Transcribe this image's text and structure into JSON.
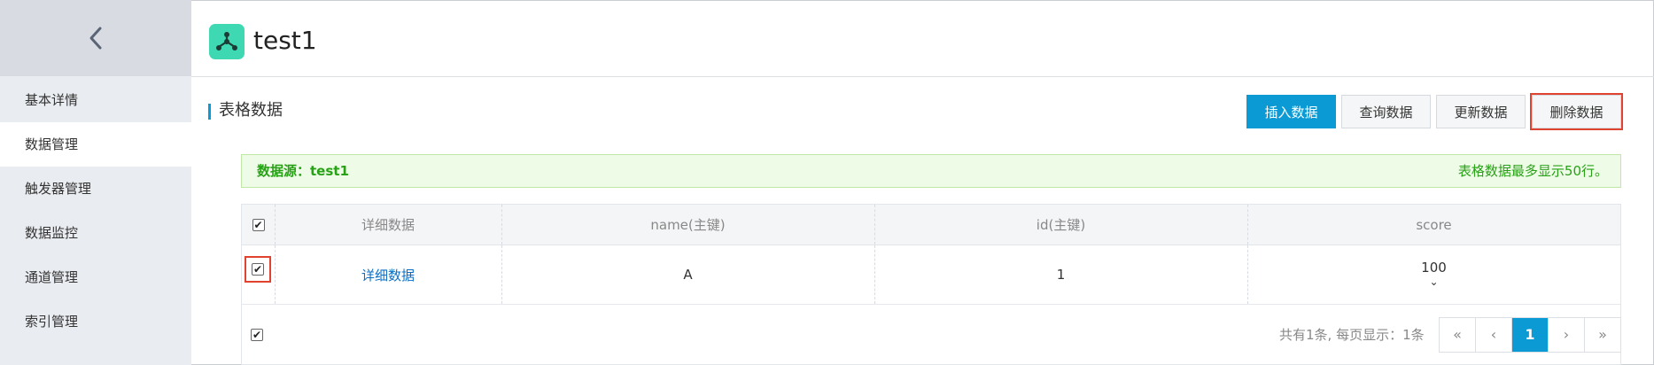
{
  "sidebar": {
    "items": [
      {
        "label": "基本详情"
      },
      {
        "label": "数据管理"
      },
      {
        "label": "触发器管理"
      },
      {
        "label": "数据监控"
      },
      {
        "label": "通道管理"
      },
      {
        "label": "索引管理"
      }
    ],
    "active_index": 1
  },
  "header": {
    "title": "test1",
    "logo_icon": "share-nodes-icon",
    "accent": "#3ed9b3"
  },
  "section": {
    "title": "表格数据"
  },
  "toolbar": {
    "insert": "插入数据",
    "query": "查询数据",
    "update": "更新数据",
    "delete": "删除数据"
  },
  "banner": {
    "left": "数据源：test1",
    "right": "表格数据最多显示50行。"
  },
  "table": {
    "headers": [
      "详细数据",
      "name(主键)",
      "id(主键)",
      "score"
    ],
    "rows": [
      {
        "checked": true,
        "detail_link": "详细数据",
        "name": "A",
        "id": "1",
        "score": "100"
      }
    ]
  },
  "pagination": {
    "info": "共有1条, 每页显示：1条",
    "first": "«",
    "prev": "‹",
    "current": "1",
    "next": "›",
    "last": "»"
  },
  "colors": {
    "primary": "#0b9ad4",
    "success": "#27a216",
    "highlight": "#e0432f"
  }
}
